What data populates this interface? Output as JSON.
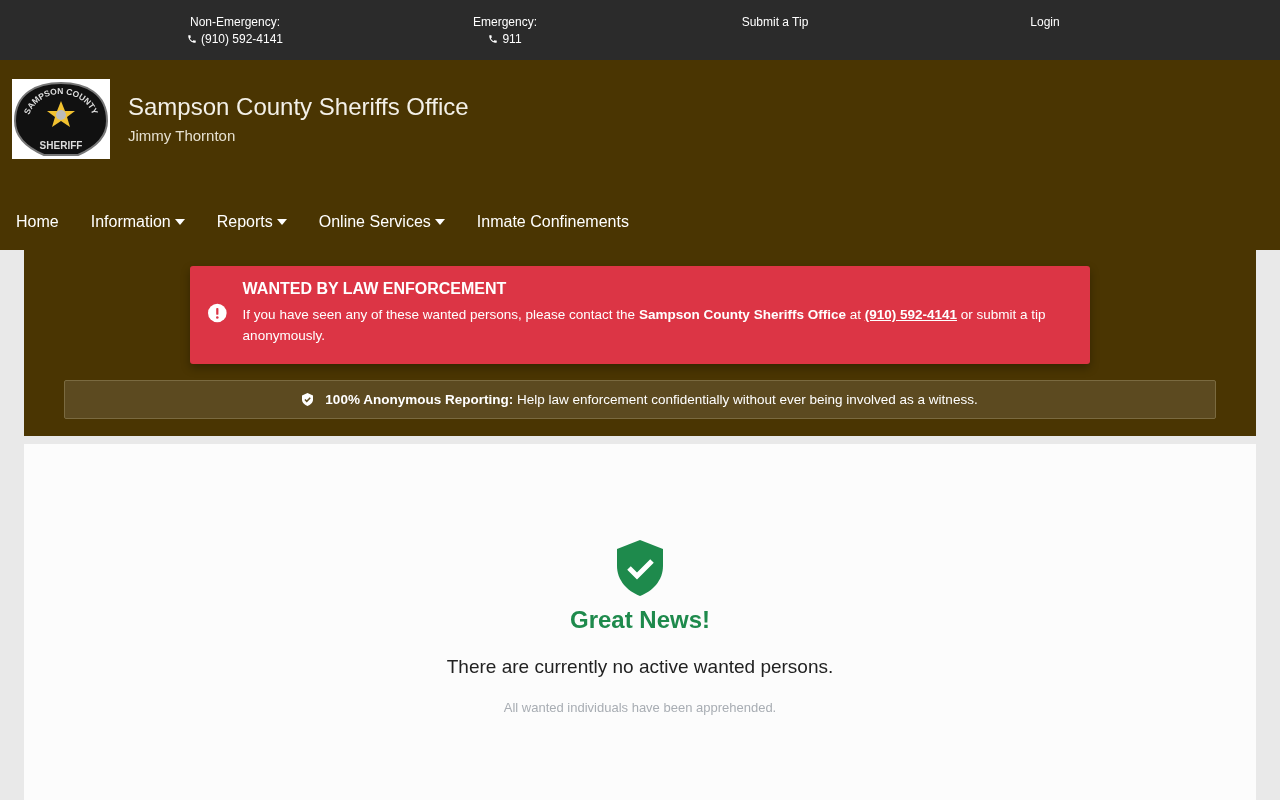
{
  "top_bar": [
    {
      "kind": "contact",
      "label": "Non-Emergency:",
      "phone": "(910) 592-4141"
    },
    {
      "kind": "contact",
      "label": "Emergency:",
      "phone": "911"
    },
    {
      "kind": "link",
      "label": "Submit a Tip"
    },
    {
      "kind": "link",
      "label": "Login"
    }
  ],
  "header": {
    "logo": {
      "top_text": "SAMPSON COUNTY",
      "bottom_text": "SHERIFF"
    },
    "title": "Sampson County Sheriffs Office",
    "subtitle": "Jimmy Thornton"
  },
  "nav": [
    {
      "label": "Home",
      "dropdown": false
    },
    {
      "label": "Information",
      "dropdown": true
    },
    {
      "label": "Reports",
      "dropdown": true
    },
    {
      "label": "Online Services",
      "dropdown": true
    },
    {
      "label": "Inmate Confinements",
      "dropdown": false
    }
  ],
  "alert": {
    "title": "WANTED BY LAW ENFORCEMENT",
    "text_before": "If you have seen any of these wanted persons, please contact the **Sampson County Sheriffs Office** at",
    "link": "(910) 592-4141",
    "text_after": "or submit a tip anonymously."
  },
  "notice": {
    "text": "**100% Anonymous Reporting:** Help law enforcement confidentially without ever being involved as a witness."
  },
  "empty_state": {
    "title": "Great News!",
    "message": "There are currently no active wanted persons.",
    "note": "All wanted individuals have been apprehended."
  }
}
